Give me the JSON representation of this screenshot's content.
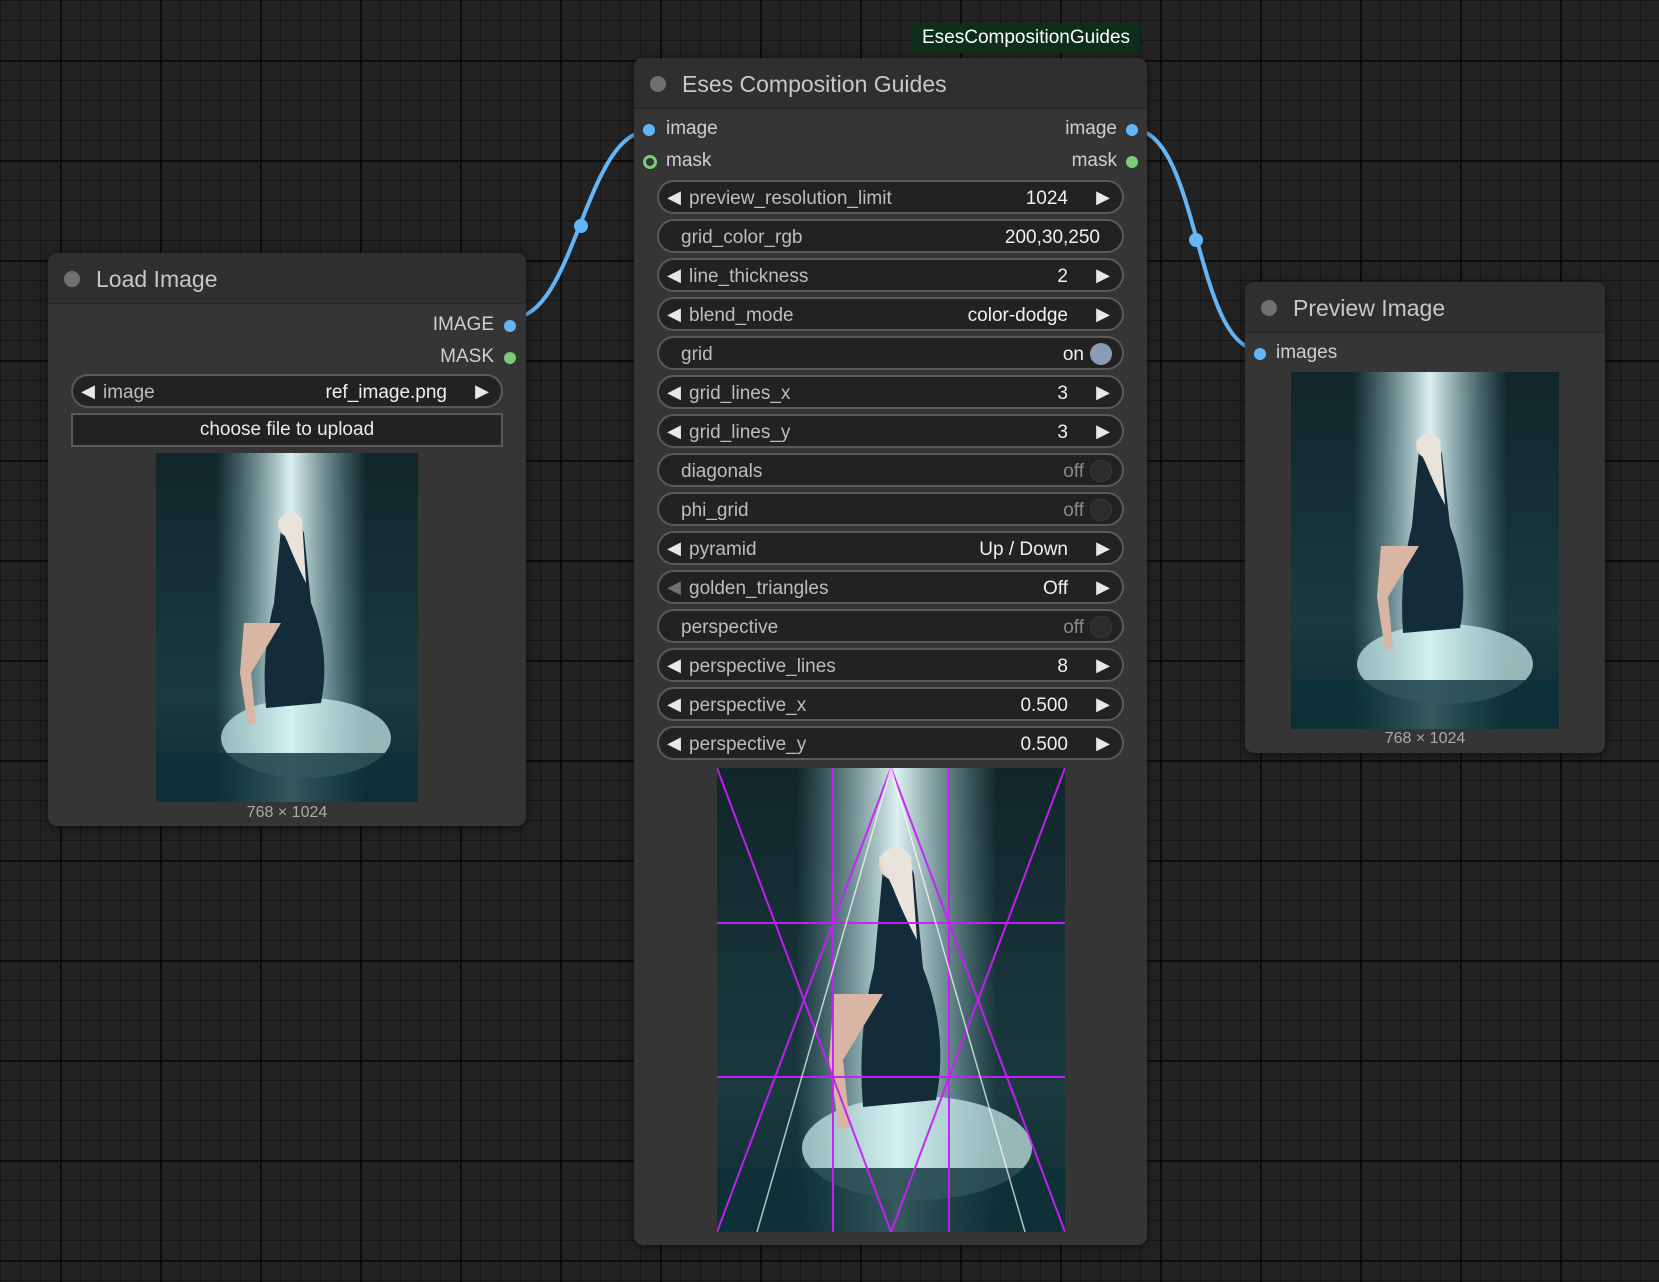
{
  "badge": {
    "text": "EsesCompositionGuides"
  },
  "load_image": {
    "title": "Load Image",
    "outputs": [
      "IMAGE",
      "MASK"
    ],
    "image_widget": {
      "label": "image",
      "value": "ref_image.png"
    },
    "upload_label": "choose file to upload",
    "dims": "768 × 1024"
  },
  "guides": {
    "title": "Eses Composition Guides",
    "inputs": [
      "image",
      "mask"
    ],
    "outputs": [
      "image",
      "mask"
    ],
    "widgets": [
      {
        "label": "preview_resolution_limit",
        "value": "1024",
        "kind": "number"
      },
      {
        "label": "grid_color_rgb",
        "value": "200,30,250",
        "kind": "text"
      },
      {
        "label": "line_thickness",
        "value": "2",
        "kind": "number"
      },
      {
        "label": "blend_mode",
        "value": "color-dodge",
        "kind": "combo"
      },
      {
        "label": "grid",
        "value": "on",
        "kind": "toggle",
        "on": true
      },
      {
        "label": "grid_lines_x",
        "value": "3",
        "kind": "number"
      },
      {
        "label": "grid_lines_y",
        "value": "3",
        "kind": "number"
      },
      {
        "label": "diagonals",
        "value": "off",
        "kind": "toggle",
        "on": false
      },
      {
        "label": "phi_grid",
        "value": "off",
        "kind": "toggle",
        "on": false
      },
      {
        "label": "pyramid",
        "value": "Up / Down",
        "kind": "combo"
      },
      {
        "label": "golden_triangles",
        "value": "Off",
        "kind": "combo",
        "left_disabled": true
      },
      {
        "label": "perspective",
        "value": "off",
        "kind": "toggle",
        "on": false
      },
      {
        "label": "perspective_lines",
        "value": "8",
        "kind": "number"
      },
      {
        "label": "perspective_x",
        "value": "0.500",
        "kind": "number"
      },
      {
        "label": "perspective_y",
        "value": "0.500",
        "kind": "number"
      }
    ]
  },
  "preview": {
    "title": "Preview Image",
    "inputs": [
      "images"
    ],
    "dims": "768 × 1024"
  },
  "colors": {
    "image_link": "#64b5f6",
    "mask_link": "#7ecb7a",
    "grid_overlay": "#c81efa",
    "badge_bg": "#0c2e1a"
  }
}
